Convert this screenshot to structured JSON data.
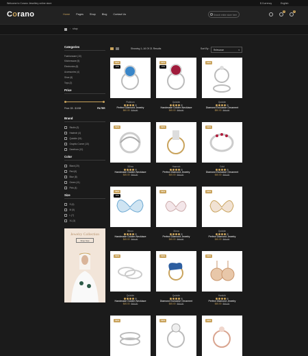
{
  "topbar": {
    "welcome": "Welcome to Corano Jewellery online store",
    "currency": "$ Currency",
    "language": "English"
  },
  "header": {
    "logo_pre": "C",
    "logo_o": "o",
    "logo_post": "rano",
    "nav": [
      "Home",
      "Pages",
      "Shop",
      "Blog",
      "Contact Us"
    ],
    "search_placeholder": "Search entire store here",
    "wishlist_count": "0",
    "cart_count": "2"
  },
  "breadcrumb": {
    "current": "shop"
  },
  "sidebar": {
    "categories_title": "Categories",
    "categories": [
      "Fashionware (10)",
      "Kitchenware (5)",
      "Electronics (8)",
      "Accessories (4)",
      "Shoe (6)",
      "Toys (2)"
    ],
    "price_title": "Price",
    "price_label": "Price: $5 - $1008",
    "filter_label": "FILTER",
    "brand_title": "Brand",
    "brands": [
      "Studio (3)",
      "Hastech (4)",
      "Quickiin (15)",
      "Graphic Corner (10)",
      "Deerfrom (12)"
    ],
    "color_title": "Color",
    "colors": [
      "Black (20)",
      "Red (6)",
      "Blue (8)",
      "Green (11)",
      "Pink (4)"
    ],
    "size_title": "Size",
    "sizes": [
      "S (4)",
      "M (5)",
      "L (7)",
      "XL (3)"
    ],
    "promo_title": "Jewelry Collection",
    "promo_button": "Shop Now"
  },
  "toolbar": {
    "showing": "Showing 1–16 Of 21 Results",
    "sort_label": "Sort By :",
    "sort_value": "Relevance"
  },
  "products": [
    {
      "tag": "NEW",
      "tag2": "-10%",
      "brand": "Platinum",
      "name": "Perfect Diamond Jewelry",
      "price": "$60.00",
      "old": "$70.00",
      "stars": 4,
      "icon": "ring-blue-gem"
    },
    {
      "tag": "NEW",
      "tag2": "-10%",
      "brand": "Quickiin",
      "name": "Handmade Golden Necklace",
      "price": "$45.00",
      "old": "$55.00",
      "stars": 4,
      "icon": "ring-red-gem"
    },
    {
      "tag": "NEW",
      "tag2": "",
      "brand": "Quickiin",
      "name": "Diamond Exclusive Ornament",
      "price": "$50.00",
      "old": "$60.00",
      "stars": 4,
      "icon": "ring-set"
    },
    {
      "tag": "NEW",
      "tag2": "",
      "brand": "3Dlow",
      "name": "Handmade Golden Necklace",
      "price": "$45.00",
      "old": "$60.00",
      "stars": 4,
      "icon": "ring-twist"
    },
    {
      "tag": "NEW",
      "tag2": "",
      "brand": "Hasmob",
      "name": "Perfect Diamond Jewelry",
      "price": "$45.00",
      "old": "$60.00",
      "stars": 4,
      "icon": "ring-gold-band"
    },
    {
      "tag": "NEW",
      "tag2": "",
      "brand": "Gold",
      "name": "Diamond Exclusive Ornament",
      "price": "$45.00",
      "old": "$60.00",
      "stars": 4,
      "icon": "ring-ruby-band"
    },
    {
      "tag": "NEW",
      "tag2": "-10%",
      "brand": "Bfrom",
      "name": "Handmade Golden Necklace",
      "price": "$45.00",
      "old": "$60.00",
      "stars": 4,
      "icon": "butterfly-blue"
    },
    {
      "tag": "NEW",
      "tag2": "",
      "brand": "Mona",
      "name": "Perfect Diamond Jewelry",
      "price": "$45.00",
      "old": "$60.00",
      "stars": 4,
      "icon": "butterfly-pin"
    },
    {
      "tag": "NEW",
      "tag2": "",
      "brand": "Quickiin",
      "name": "Perfect Diamond Jewelry",
      "price": "$45.00",
      "old": "$60.00",
      "stars": 4,
      "icon": "butterfly-gold"
    },
    {
      "tag": "NEW",
      "tag2": "",
      "brand": "Quickiin",
      "name": "Handmade Golden Necklace",
      "price": "$45.00",
      "old": "$60.00",
      "stars": 4,
      "icon": "double-ring"
    },
    {
      "tag": "NEW",
      "tag2": "",
      "brand": "Quickiin",
      "name": "Diamond Exclusive Ornament",
      "price": "$45.00",
      "old": "$60.00",
      "stars": 4,
      "icon": "peacock-brooch"
    },
    {
      "tag": "NEW",
      "tag2": "",
      "brand": "Hasfuth",
      "name": "Perfect Diamond Jewelry",
      "price": "$45.00",
      "old": "$60.00",
      "stars": 4,
      "icon": "earrings"
    },
    {
      "tag": "NEW",
      "tag2": "",
      "brand": "",
      "name": "",
      "price": "",
      "old": "",
      "stars": 0,
      "icon": "ring-stack"
    },
    {
      "tag": "NEW",
      "tag2": "",
      "brand": "",
      "name": "",
      "price": "",
      "old": "",
      "stars": 0,
      "icon": "ring-solitaire"
    },
    {
      "tag": "NEW",
      "tag2": "",
      "brand": "",
      "name": "",
      "price": "",
      "old": "",
      "stars": 0,
      "icon": "ring-rosegold"
    }
  ],
  "colors": {
    "accent": "#c9a35c",
    "bg": "#1b1b1b",
    "card": "#ffffff"
  }
}
